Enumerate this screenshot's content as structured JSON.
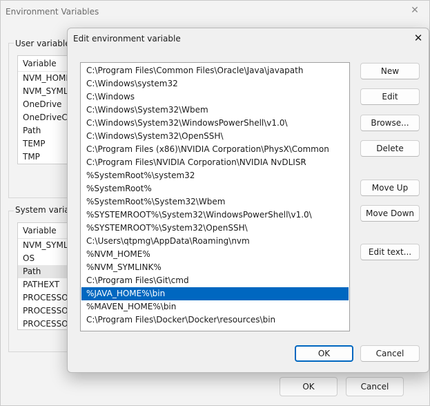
{
  "background_window": {
    "title": "Environment Variables",
    "user_group_label": "User variables f",
    "user_vars_header": "Variable",
    "user_vars": [
      "NVM_HOME",
      "NVM_SYMLIN",
      "OneDrive",
      "OneDriveCo",
      "Path",
      "TEMP",
      "TMP"
    ],
    "system_group_label": "System variabl",
    "system_vars_header": "Variable",
    "system_vars": [
      "NVM_SYMLI",
      "OS",
      "Path",
      "PATHEXT",
      "PROCESSOR",
      "PROCESSOR",
      "PROCESSOR"
    ],
    "ok_label": "OK",
    "cancel_label": "Cancel"
  },
  "dialog": {
    "title": "Edit environment variable",
    "selected_index": 17,
    "paths": [
      "C:\\Program Files\\Common Files\\Oracle\\Java\\javapath",
      "C:\\Windows\\system32",
      "C:\\Windows",
      "C:\\Windows\\System32\\Wbem",
      "C:\\Windows\\System32\\WindowsPowerShell\\v1.0\\",
      "C:\\Windows\\System32\\OpenSSH\\",
      "C:\\Program Files (x86)\\NVIDIA Corporation\\PhysX\\Common",
      "C:\\Program Files\\NVIDIA Corporation\\NVIDIA NvDLISR",
      "%SystemRoot%\\system32",
      "%SystemRoot%",
      "%SystemRoot%\\System32\\Wbem",
      "%SYSTEMROOT%\\System32\\WindowsPowerShell\\v1.0\\",
      "%SYSTEMROOT%\\System32\\OpenSSH\\",
      "C:\\Users\\qtpmg\\AppData\\Roaming\\nvm",
      "%NVM_HOME%",
      "%NVM_SYMLINK%",
      "C:\\Program Files\\Git\\cmd",
      "%JAVA_HOME%\\bin",
      "%MAVEN_HOME%\\bin",
      "C:\\Program Files\\Docker\\Docker\\resources\\bin"
    ],
    "buttons": {
      "new": "New",
      "edit": "Edit",
      "browse": "Browse...",
      "delete": "Delete",
      "move_up": "Move Up",
      "move_down": "Move Down",
      "edit_text": "Edit text...",
      "ok": "OK",
      "cancel": "Cancel"
    },
    "accent_color": "#0067c0"
  }
}
